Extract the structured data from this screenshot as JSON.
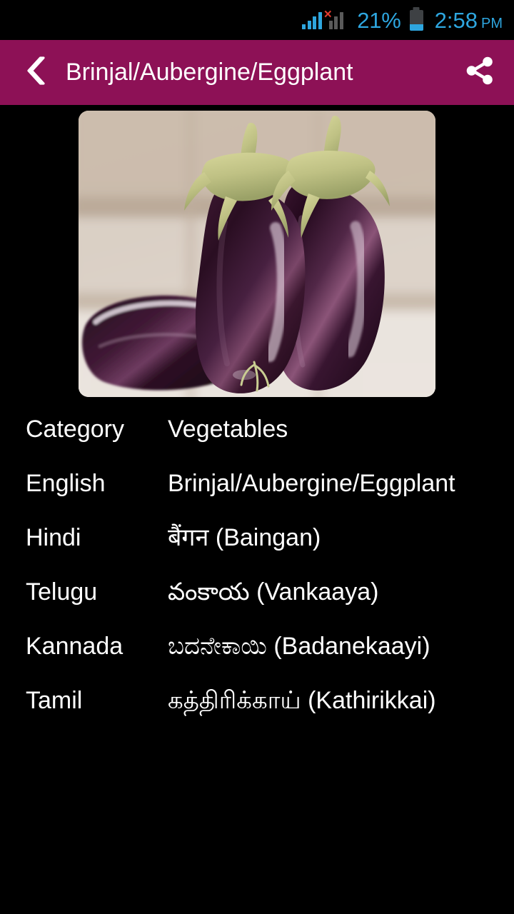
{
  "status_bar": {
    "signal_primary_icon": "signal-bars-icon",
    "signal_secondary_icon": "signal-bars-no-service-icon",
    "no_service_mark": "×",
    "battery_percent": "21%",
    "battery_icon": "battery-icon",
    "battery_level": 21,
    "time": "2:58",
    "time_period": "PM",
    "accent_color": "#2EA6DF",
    "alert_color": "#E23B2E",
    "background_color": "#000000"
  },
  "app_bar": {
    "back_icon": "back-chevron-icon",
    "title": "Brinjal/Aubergine/Eggplant",
    "share_icon": "share-icon",
    "background_color": "#8D1156",
    "text_color": "#FFFFFF"
  },
  "hero": {
    "image_name": "eggplant-photo",
    "alt": "Two dark purple eggplants with green stems on a light wooden surface"
  },
  "details": {
    "rows": [
      {
        "label": "Category",
        "value": "Vegetables"
      },
      {
        "label": "English",
        "value": "Brinjal/Aubergine/Eggplant"
      },
      {
        "label": "Hindi",
        "native": "बैंगन",
        "roman": "(Baingan)"
      },
      {
        "label": "Telugu",
        "native": "వంకాయ",
        "roman": "(Vankaaya)"
      },
      {
        "label": "Kannada",
        "native": "ಬದನೇಕಾಯಿ",
        "roman": "(Badanekaayi)"
      },
      {
        "label": "Tamil",
        "native": "கத்திரிக்காய்",
        "roman": "(Kathirikkai)"
      }
    ]
  }
}
